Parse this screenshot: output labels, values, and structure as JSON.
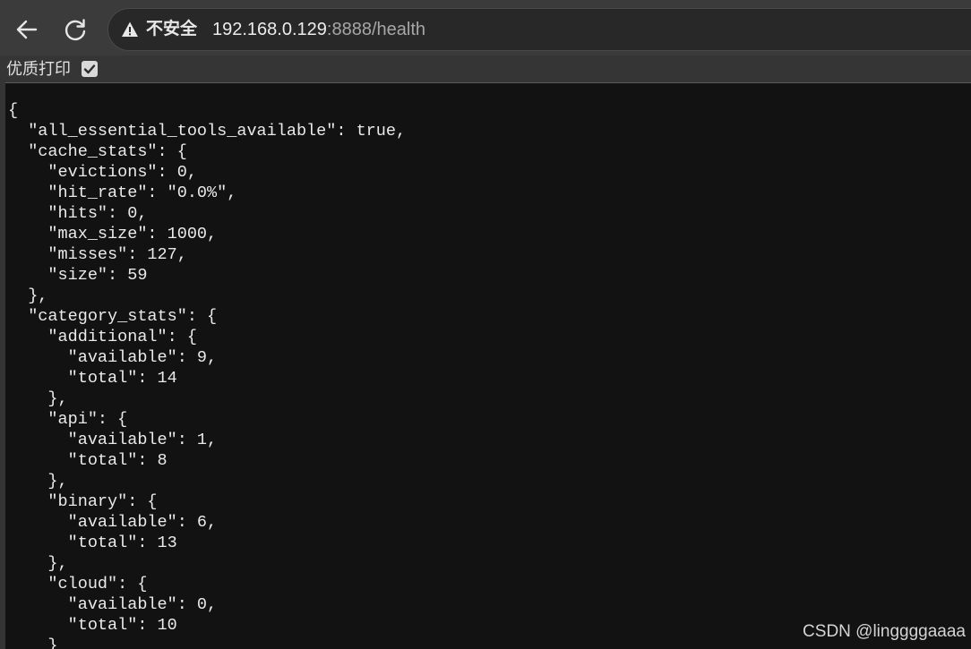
{
  "browser": {
    "security_label": "不安全",
    "url_host": "192.168.0.129",
    "url_rest": ":8888/health",
    "back_icon": "back-arrow-icon",
    "reload_icon": "reload-icon",
    "warning_icon": "warning-triangle-icon"
  },
  "pretty_print": {
    "label": "优质打印",
    "checked": true
  },
  "json_lines": [
    "{",
    "  \"all_essential_tools_available\": true,",
    "  \"cache_stats\": {",
    "    \"evictions\": 0,",
    "    \"hit_rate\": \"0.0%\",",
    "    \"hits\": 0,",
    "    \"max_size\": 1000,",
    "    \"misses\": 127,",
    "    \"size\": 59",
    "  },",
    "  \"category_stats\": {",
    "    \"additional\": {",
    "      \"available\": 9,",
    "      \"total\": 14",
    "    },",
    "    \"api\": {",
    "      \"available\": 1,",
    "      \"total\": 8",
    "    },",
    "    \"binary\": {",
    "      \"available\": 6,",
    "      \"total\": 13",
    "    },",
    "    \"cloud\": {",
    "      \"available\": 0,",
    "      \"total\": 10",
    "    }"
  ],
  "watermark": "CSDN @linggggaaaa"
}
